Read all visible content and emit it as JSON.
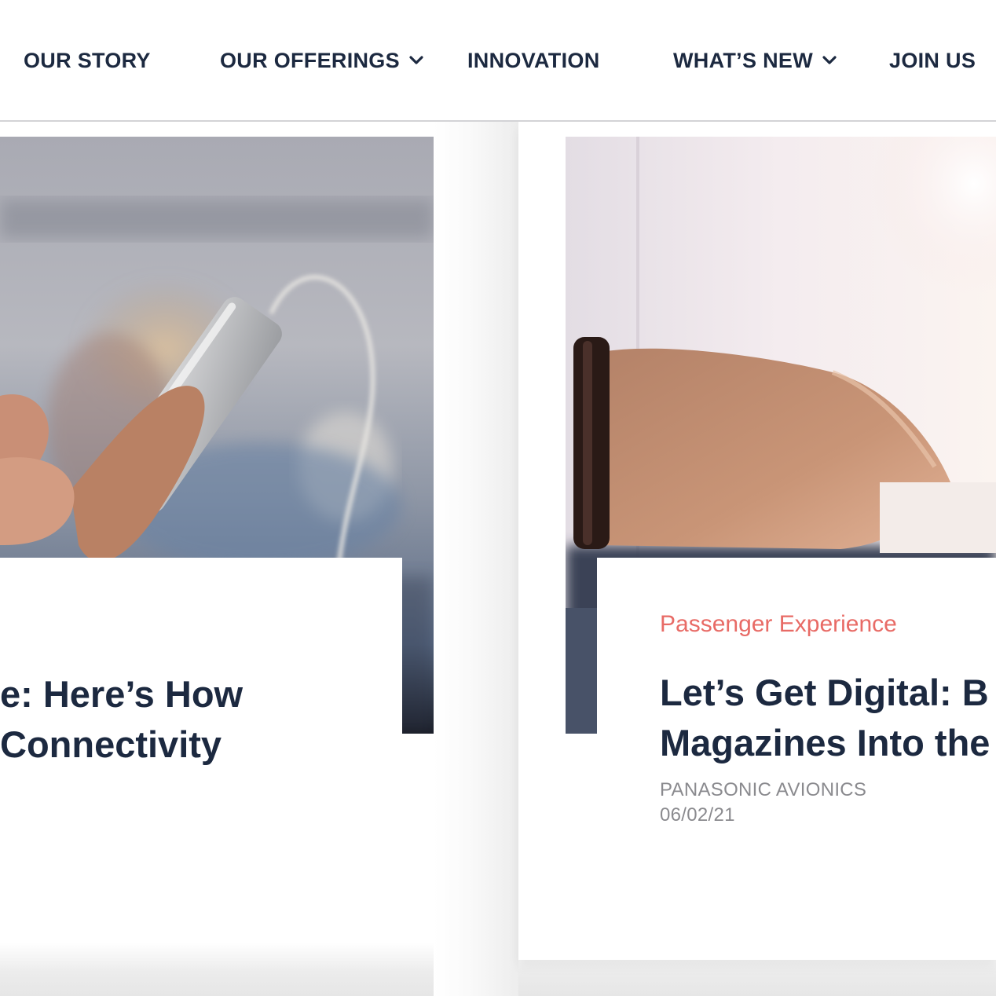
{
  "nav": {
    "items": [
      {
        "label": "OUR STORY",
        "dropdown": false
      },
      {
        "label": "OUR OFFERINGS",
        "dropdown": true
      },
      {
        "label": "INNOVATION",
        "dropdown": false
      },
      {
        "label": "WHAT’S NEW",
        "dropdown": true
      },
      {
        "label": "JOIN US",
        "dropdown": false
      }
    ]
  },
  "cards": [
    {
      "image": "passenger-holding-smartphone-with-earphone-cable",
      "title_line1": "e: Here’s How",
      "title_line2": "Connectivity"
    },
    {
      "image": "wrist-with-bracelet-by-airplane-window",
      "category": "Passenger Experience",
      "title_line1": "Let’s Get Digital: B",
      "title_line2": "Magazines Into the",
      "author": "PANASONIC AVIONICS",
      "date": "06/02/21"
    }
  ],
  "colors": {
    "navy": "#1c2940",
    "category_coral": "#e86b66",
    "meta_gray": "#8a8a8e",
    "divider": "#d3d3d6"
  }
}
